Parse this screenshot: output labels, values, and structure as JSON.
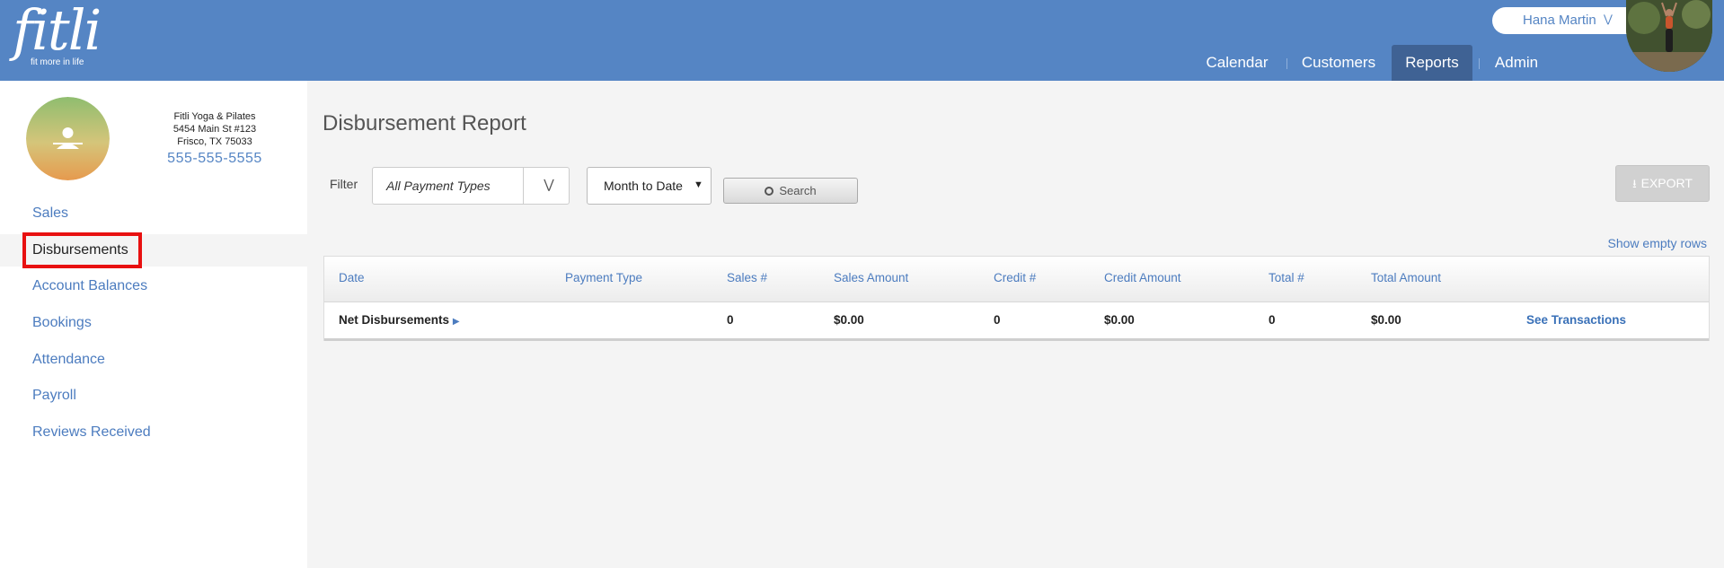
{
  "brand": {
    "logo_text": "fitli",
    "tagline": "fit more in life"
  },
  "user": {
    "name": "Hana Martin",
    "chevron": "»"
  },
  "nav": {
    "tabs": [
      "Calendar",
      "Customers",
      "Reports",
      "Admin"
    ],
    "active": "Reports"
  },
  "studio": {
    "name": "Fitli Yoga & Pilates",
    "address1": "5454 Main St #123",
    "address2": "Frisco, TX 75033",
    "phone": "555-555-5555"
  },
  "sidebar": {
    "items": [
      {
        "label": "Sales"
      },
      {
        "label": "Disbursements"
      },
      {
        "label": "Account Balances"
      },
      {
        "label": "Bookings"
      },
      {
        "label": "Attendance"
      },
      {
        "label": "Payroll"
      },
      {
        "label": "Reviews Received"
      }
    ],
    "active": "Disbursements"
  },
  "page": {
    "title": "Disbursement Report"
  },
  "filters": {
    "label": "Filter",
    "payment_type": "All Payment Types",
    "period": "Month to Date",
    "search_label": "Search",
    "export_label": "EXPORT",
    "show_empty_rows": "Show empty rows"
  },
  "table": {
    "columns": [
      "Date",
      "Payment Type",
      "Sales #",
      "Sales Amount",
      "Credit #",
      "Credit Amount",
      "Total #",
      "Total Amount"
    ],
    "rows": [
      {
        "label": "Net Disbursements",
        "sales_count": "0",
        "sales_amount": "$0.00",
        "credit_count": "0",
        "credit_amount": "$0.00",
        "total_count": "0",
        "total_amount": "$0.00",
        "action": "See Transactions"
      }
    ]
  },
  "colors": {
    "header": "#5585c4",
    "active_tab": "#3f6294",
    "link": "#4c7cbf",
    "highlight": "#e81010"
  }
}
